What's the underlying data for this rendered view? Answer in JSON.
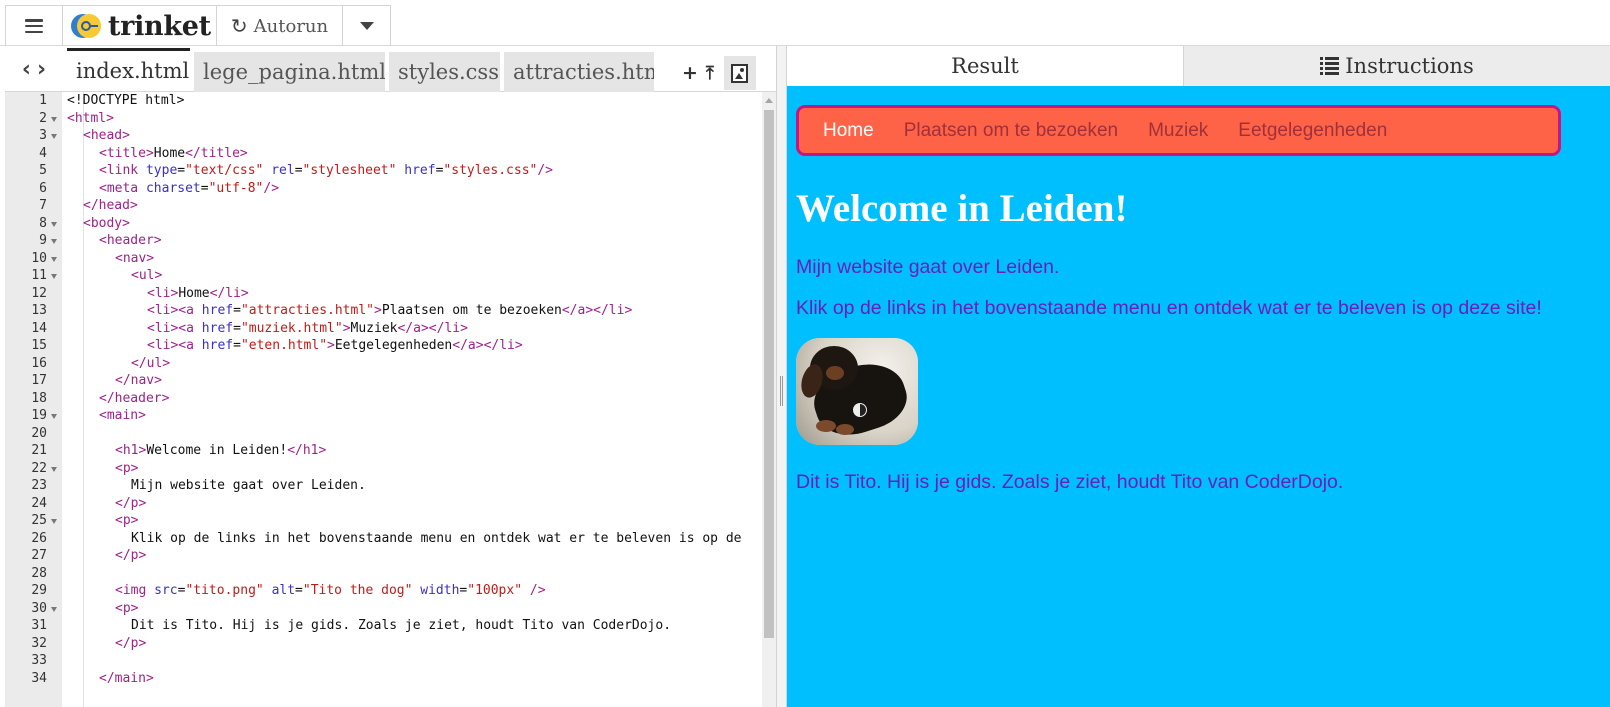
{
  "topbar": {
    "logo_text": "trinket",
    "autorun_label": "Autorun"
  },
  "editor": {
    "tabs": [
      "index.html",
      "lege_pagina.html",
      "styles.css",
      "attracties.html"
    ],
    "active_tab": "index.html"
  },
  "code_lines": [
    {
      "n": "1",
      "fold": false,
      "indent": 0,
      "html": "<span class='tx'>&lt;!DOCTYPE html&gt;</span>"
    },
    {
      "n": "2",
      "fold": true,
      "indent": 0,
      "html": "<span class='t'>&lt;html&gt;</span>"
    },
    {
      "n": "3",
      "fold": true,
      "indent": 1,
      "html": "<span class='t'>&lt;head&gt;</span>"
    },
    {
      "n": "4",
      "fold": false,
      "indent": 2,
      "html": "<span class='t'>&lt;title&gt;</span><span class='tx'>Home</span><span class='t'>&lt;/title&gt;</span>"
    },
    {
      "n": "5",
      "fold": false,
      "indent": 2,
      "html": "<span class='t'>&lt;link </span><span class='a'>type</span><span class='tx'>=</span><span class='s'>\"text/css\"</span> <span class='a'>rel</span><span class='tx'>=</span><span class='s'>\"stylesheet\"</span> <span class='a'>href</span><span class='tx'>=</span><span class='s'>\"styles.css\"</span><span class='t'>/&gt;</span>"
    },
    {
      "n": "6",
      "fold": false,
      "indent": 2,
      "html": "<span class='t'>&lt;meta </span><span class='a'>charset</span><span class='tx'>=</span><span class='s'>\"utf-8\"</span><span class='t'>/&gt;</span>"
    },
    {
      "n": "7",
      "fold": false,
      "indent": 1,
      "html": "<span class='t'>&lt;/head&gt;</span>"
    },
    {
      "n": "8",
      "fold": true,
      "indent": 1,
      "html": "<span class='t'>&lt;body&gt;</span>"
    },
    {
      "n": "9",
      "fold": true,
      "indent": 2,
      "html": "<span class='t'>&lt;header&gt;</span>"
    },
    {
      "n": "10",
      "fold": true,
      "indent": 3,
      "html": "<span class='t'>&lt;nav&gt;</span>"
    },
    {
      "n": "11",
      "fold": true,
      "indent": 4,
      "html": "<span class='t'>&lt;ul&gt;</span>"
    },
    {
      "n": "12",
      "fold": false,
      "indent": 5,
      "html": "<span class='t'>&lt;li&gt;</span><span class='tx'>Home</span><span class='t'>&lt;/li&gt;</span>"
    },
    {
      "n": "13",
      "fold": false,
      "indent": 5,
      "html": "<span class='t'>&lt;li&gt;&lt;a </span><span class='a'>href</span><span class='tx'>=</span><span class='s'>\"attracties.html\"</span><span class='t'>&gt;</span><span class='tx'>Plaatsen om te bezoeken</span><span class='t'>&lt;/a&gt;&lt;/li&gt;</span>"
    },
    {
      "n": "14",
      "fold": false,
      "indent": 5,
      "html": "<span class='t'>&lt;li&gt;&lt;a </span><span class='a'>href</span><span class='tx'>=</span><span class='s'>\"muziek.html\"</span><span class='t'>&gt;</span><span class='tx'>Muziek</span><span class='t'>&lt;/a&gt;&lt;/li&gt;</span>"
    },
    {
      "n": "15",
      "fold": false,
      "indent": 5,
      "html": "<span class='t'>&lt;li&gt;&lt;a </span><span class='a'>href</span><span class='tx'>=</span><span class='s'>\"eten.html\"</span><span class='t'>&gt;</span><span class='tx'>Eetgelegenheden</span><span class='t'>&lt;/a&gt;&lt;/li&gt;</span>"
    },
    {
      "n": "16",
      "fold": false,
      "indent": 4,
      "html": "<span class='t'>&lt;/ul&gt;</span>"
    },
    {
      "n": "17",
      "fold": false,
      "indent": 3,
      "html": "<span class='t'>&lt;/nav&gt;</span>"
    },
    {
      "n": "18",
      "fold": false,
      "indent": 2,
      "html": "<span class='t'>&lt;/header&gt;</span>"
    },
    {
      "n": "19",
      "fold": true,
      "indent": 2,
      "html": "<span class='t'>&lt;main&gt;</span>"
    },
    {
      "n": "20",
      "fold": false,
      "indent": 2,
      "html": ""
    },
    {
      "n": "21",
      "fold": false,
      "indent": 3,
      "html": "<span class='t'>&lt;h1&gt;</span><span class='tx'>Welcome in Leiden!</span><span class='t'>&lt;/h1&gt;</span>"
    },
    {
      "n": "22",
      "fold": true,
      "indent": 3,
      "html": "<span class='t'>&lt;p&gt;</span>"
    },
    {
      "n": "23",
      "fold": false,
      "indent": 4,
      "html": "<span class='tx'>Mijn website gaat over Leiden.</span>"
    },
    {
      "n": "24",
      "fold": false,
      "indent": 3,
      "html": "<span class='t'>&lt;/p&gt;</span>"
    },
    {
      "n": "25",
      "fold": true,
      "indent": 3,
      "html": "<span class='t'>&lt;p&gt;</span>"
    },
    {
      "n": "26",
      "fold": false,
      "indent": 4,
      "html": "<span class='tx'>Klik op de links in het bovenstaande menu en ontdek wat er te beleven is op de</span>"
    },
    {
      "n": "27",
      "fold": false,
      "indent": 3,
      "html": "<span class='t'>&lt;/p&gt;</span>"
    },
    {
      "n": "28",
      "fold": false,
      "indent": 3,
      "html": ""
    },
    {
      "n": "29",
      "fold": false,
      "indent": 3,
      "html": "<span class='t'>&lt;img </span><span class='a'>src</span><span class='tx'>=</span><span class='s'>\"tito.png\"</span> <span class='a'>alt</span><span class='tx'>=</span><span class='s'>\"Tito the dog\"</span> <span class='a'>width</span><span class='tx'>=</span><span class='s'>\"100px\"</span> <span class='t'>/&gt;</span>"
    },
    {
      "n": "30",
      "fold": true,
      "indent": 3,
      "html": "<span class='t'>&lt;p&gt;</span>"
    },
    {
      "n": "31",
      "fold": false,
      "indent": 4,
      "html": "<span class='tx'>Dit is Tito. Hij is je gids. Zoals je ziet, houdt Tito van CoderDojo.</span>"
    },
    {
      "n": "32",
      "fold": false,
      "indent": 3,
      "html": "<span class='t'>&lt;/p&gt;</span>"
    },
    {
      "n": "33",
      "fold": false,
      "indent": 3,
      "html": ""
    },
    {
      "n": "34",
      "fold": false,
      "indent": 2,
      "html": "<span class='t'>&lt;/main&gt;</span>"
    }
  ],
  "output": {
    "tab_result": "Result",
    "tab_instructions": "Instructions",
    "nav": [
      "Home",
      "Plaatsen om te bezoeken",
      "Muziek",
      "Eetgelegenheden"
    ],
    "heading": "Welcome in Leiden!",
    "p1": "Mijn website gaat over Leiden.",
    "p2": "Klik op de links in het bovenstaande menu en ontdek wat er te beleven is op deze site!",
    "p3": "Dit is Tito. Hij is je gids. Zoals je ziet, houdt Tito van CoderDojo."
  },
  "colors": {
    "stage_bg": "#00bfff",
    "nav_bg": "#ff6347",
    "nav_border": "#c71585",
    "para_text": "#6a1fb8",
    "heading_text": "#ffffff"
  }
}
